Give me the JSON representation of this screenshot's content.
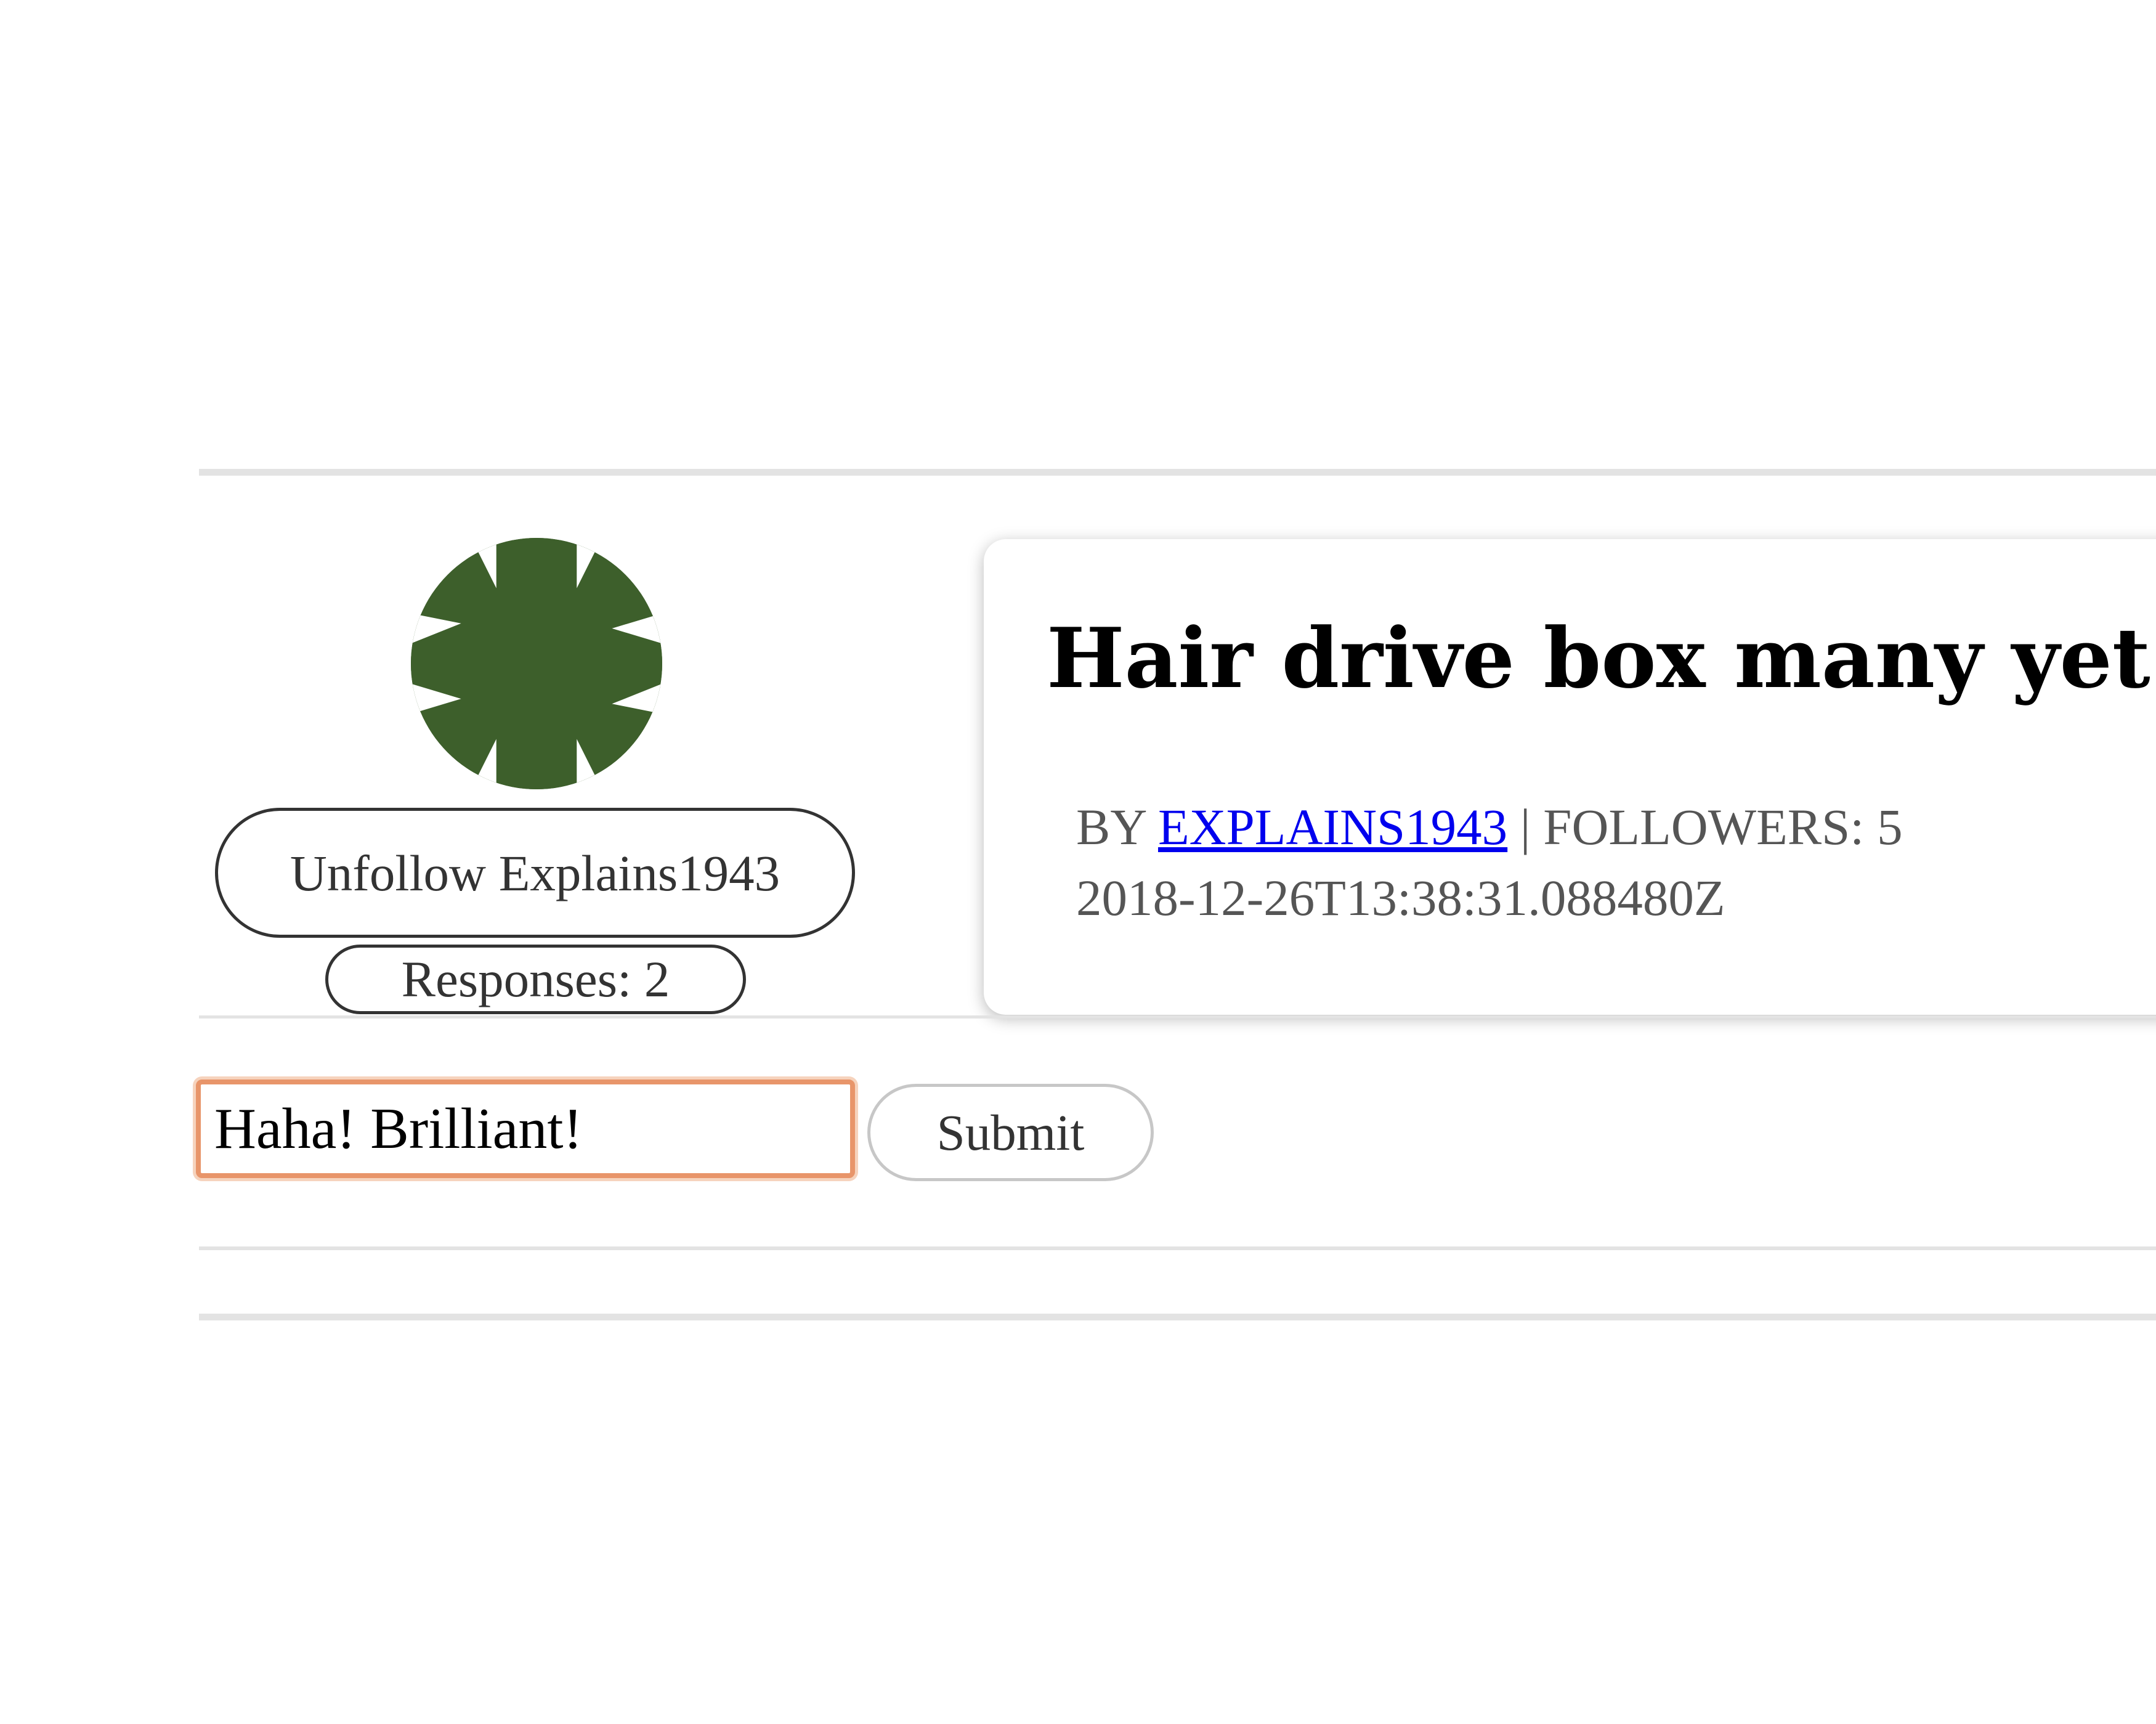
{
  "author_panel": {
    "avatar_icon": "pinwheel-avatar-icon",
    "avatar_color": "#3d5f2b",
    "unfollow_label": "Unfollow Explains1943",
    "responses_label": "Responses: 2"
  },
  "post": {
    "title": "Hair drive box many yet.",
    "by_prefix": "BY ",
    "author": "EXPLAINS1943",
    "separator": " | ",
    "followers_label": "FOLLOWERS: 5",
    "timestamp": "2018-12-26T13:38:31.088480Z"
  },
  "comment_form": {
    "input_value": "Haha! Brilliant!",
    "submit_label": "Submit",
    "focus_color": "#e8956a"
  }
}
